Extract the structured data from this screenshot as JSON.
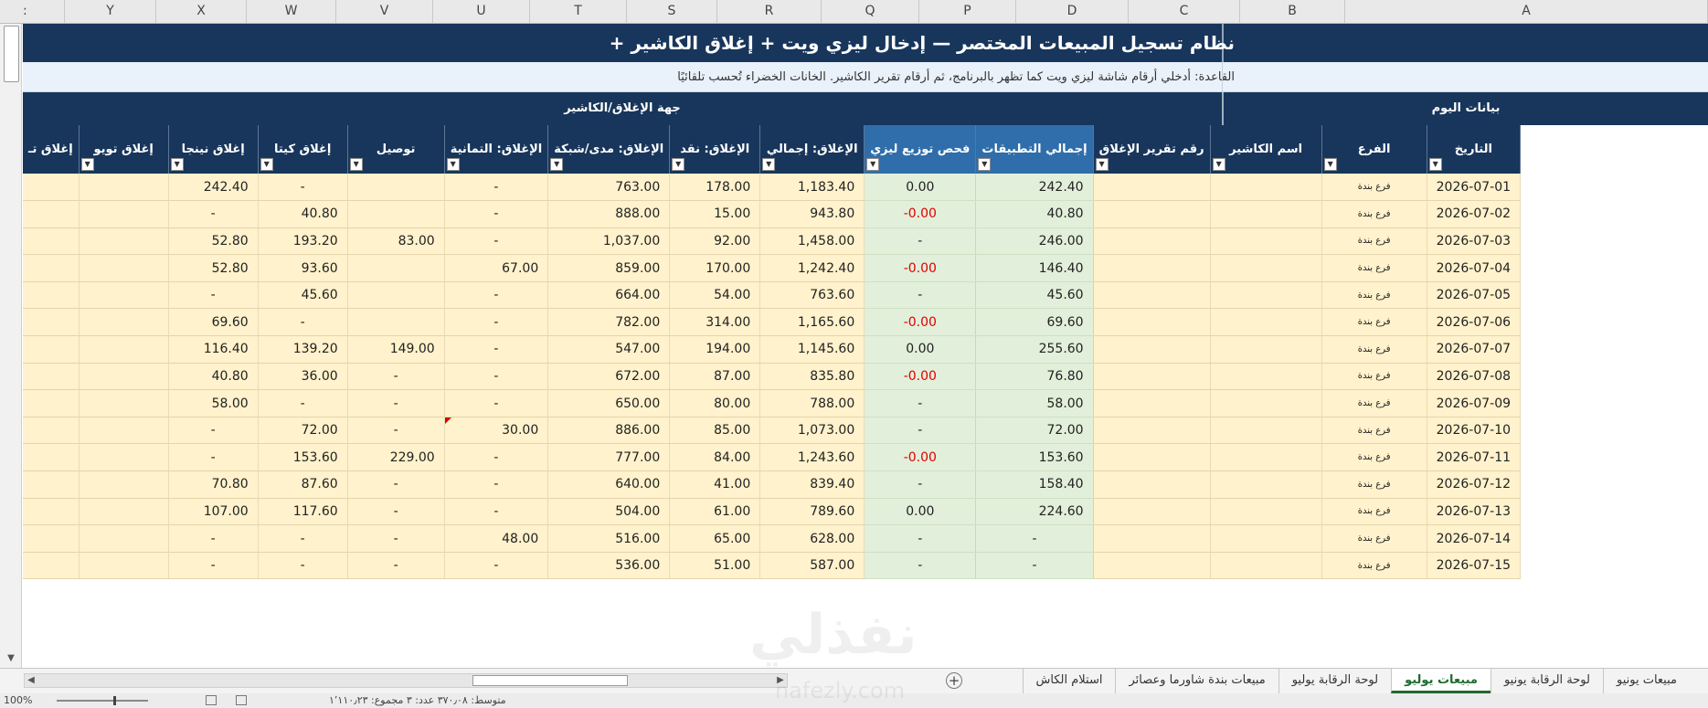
{
  "column_letters": [
    "Y",
    "X",
    "W",
    "V",
    "U",
    "T",
    "S",
    "R",
    "Q",
    "P",
    "D",
    "C",
    "B",
    "A"
  ],
  "left_edge_letter": ":",
  "sheet_title": "نظام تسجيل المبيعات المختصر — إدخال ليزي ويت + إغلاق الكاشير +",
  "rule_text": "القاعدة: أدخلي أرقام شاشة ليزي ويت كما تظهر بالبرنامج، ثم أرقام تقرير الكاشير. الخانات الخضراء تُحسب تلقائيًا",
  "groups": {
    "closing": "جهة الإغلاق/الكاشير",
    "today": "بيانات اليوم"
  },
  "headers": [
    "إغلاق تـ",
    "إغلاق تويو",
    "إغلاق نينجا",
    "إغلاق كيتا",
    "توصيل",
    "الإغلاق: التمانية",
    "الإغلاق: مدى/شبكة",
    "الإغلاق: نقد",
    "الإغلاق: إجمالي",
    "فحص توزيع ليزي",
    "إجمالي التطبيقات",
    "رقم تقرير الإغلاق",
    "اسم الكاشير",
    "الفرع",
    "التاريخ"
  ],
  "rows": [
    [
      "",
      "",
      "242.40",
      "-",
      "",
      "-",
      "763.00",
      "178.00",
      "1,183.40",
      "0.00",
      "242.40",
      "",
      "",
      "فرع بندة",
      "2026-07-01"
    ],
    [
      "",
      "",
      "-",
      "40.80",
      "",
      "-",
      "888.00",
      "15.00",
      "943.80",
      "-0.00",
      "40.80",
      "",
      "",
      "فرع بندة",
      "2026-07-02"
    ],
    [
      "",
      "",
      "52.80",
      "193.20",
      "83.00",
      "-",
      "1,037.00",
      "92.00",
      "1,458.00",
      "-",
      "246.00",
      "",
      "",
      "فرع بندة",
      "2026-07-03"
    ],
    [
      "",
      "",
      "52.80",
      "93.60",
      "",
      "67.00",
      "859.00",
      "170.00",
      "1,242.40",
      "-0.00",
      "146.40",
      "",
      "",
      "فرع بندة",
      "2026-07-04"
    ],
    [
      "",
      "",
      "-",
      "45.60",
      "",
      "-",
      "664.00",
      "54.00",
      "763.60",
      "-",
      "45.60",
      "",
      "",
      "فرع بندة",
      "2026-07-05"
    ],
    [
      "",
      "",
      "69.60",
      "-",
      "",
      "-",
      "782.00",
      "314.00",
      "1,165.60",
      "-0.00",
      "69.60",
      "",
      "",
      "فرع بندة",
      "2026-07-06"
    ],
    [
      "",
      "",
      "116.40",
      "139.20",
      "149.00",
      "-",
      "547.00",
      "194.00",
      "1,145.60",
      "0.00",
      "255.60",
      "",
      "",
      "فرع بندة",
      "2026-07-07"
    ],
    [
      "",
      "",
      "40.80",
      "36.00",
      "-",
      "-",
      "672.00",
      "87.00",
      "835.80",
      "-0.00",
      "76.80",
      "",
      "",
      "فرع بندة",
      "2026-07-08"
    ],
    [
      "",
      "",
      "58.00",
      "-",
      "-",
      "-",
      "650.00",
      "80.00",
      "788.00",
      "-",
      "58.00",
      "",
      "",
      "فرع بندة",
      "2026-07-09"
    ],
    [
      "",
      "",
      "-",
      "72.00",
      "-",
      "30.00",
      "886.00",
      "85.00",
      "1,073.00",
      "-",
      "72.00",
      "",
      "",
      "فرع بندة",
      "2026-07-10"
    ],
    [
      "",
      "",
      "-",
      "153.60",
      "229.00",
      "-",
      "777.00",
      "84.00",
      "1,243.60",
      "-0.00",
      "153.60",
      "",
      "",
      "فرع بندة",
      "2026-07-11"
    ],
    [
      "",
      "",
      "70.80",
      "87.60",
      "-",
      "-",
      "640.00",
      "41.00",
      "839.40",
      "-",
      "158.40",
      "",
      "",
      "فرع بندة",
      "2026-07-12"
    ],
    [
      "",
      "",
      "107.00",
      "117.60",
      "-",
      "-",
      "504.00",
      "61.00",
      "789.60",
      "0.00",
      "224.60",
      "",
      "",
      "فرع بندة",
      "2026-07-13"
    ],
    [
      "",
      "",
      "-",
      "-",
      "-",
      "48.00",
      "516.00",
      "65.00",
      "628.00",
      "-",
      "-",
      "",
      "",
      "فرع بندة",
      "2026-07-14"
    ],
    [
      "",
      "",
      "-",
      "-",
      "-",
      "-",
      "536.00",
      "51.00",
      "587.00",
      "-",
      "-",
      "",
      "",
      "فرع بندة",
      "2026-07-15"
    ]
  ],
  "tabs": [
    "مبيعات يونيو",
    "لوحة الرقابة يونيو",
    "مبيعات يوليو",
    "لوحة الرقابة يوليو",
    "مبيعات بندة شاورما وعصائر",
    "استلام الكاش"
  ],
  "active_tab": "مبيعات يوليو",
  "statusbar": {
    "zoom": "100%",
    "summary": "متوسط: ٣٧٠٫٠٨   عدد: ٣   مجموع: ١٬١١٠٫٢٣"
  },
  "watermark": {
    "text": "نفذلي",
    "sub": "nafezly.com"
  },
  "colors": {
    "header_navy": "#18365c",
    "header_highlight": "#2f6eaa",
    "cell_yellow": "#fff2cc",
    "cell_green": "#e2efda",
    "negative_red": "#e00000",
    "active_tab_green": "#1e6b2e"
  }
}
